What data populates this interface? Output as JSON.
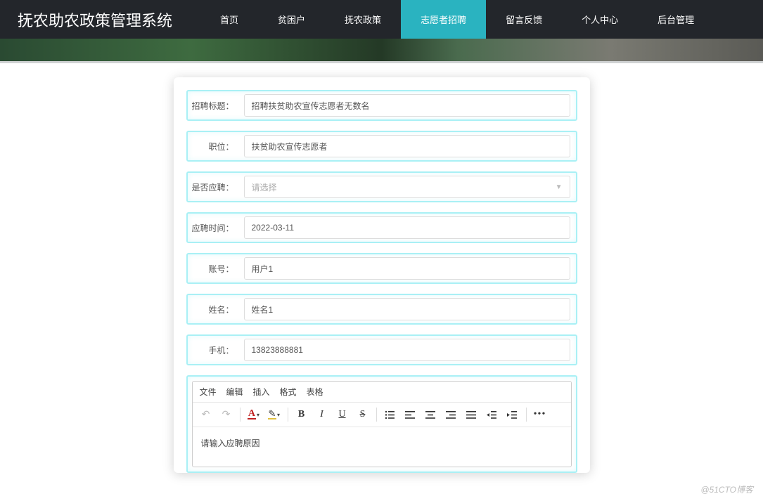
{
  "brand": "抚农助农政策管理系统",
  "nav": {
    "items": [
      {
        "label": "首页",
        "active": false
      },
      {
        "label": "贫困户",
        "active": false
      },
      {
        "label": "抚农政策",
        "active": false
      },
      {
        "label": "志愿者招聘",
        "active": true
      },
      {
        "label": "留言反馈",
        "active": false
      },
      {
        "label": "个人中心",
        "active": false
      },
      {
        "label": "后台管理",
        "active": false
      }
    ]
  },
  "form": {
    "title": {
      "label": "招聘标题：",
      "value": "招聘扶贫助农宣传志愿者无数名"
    },
    "position": {
      "label": "职位：",
      "value": "扶贫助农宣传志愿者"
    },
    "apply": {
      "label": "是否应聘：",
      "placeholder": "请选择"
    },
    "time": {
      "label": "应聘时间：",
      "value": "2022-03-11"
    },
    "account": {
      "label": "账号：",
      "value": "用户1"
    },
    "name": {
      "label": "姓名：",
      "value": "姓名1"
    },
    "phone": {
      "label": "手机：",
      "value": "13823888881"
    }
  },
  "editor": {
    "menus": [
      "文件",
      "编辑",
      "插入",
      "格式",
      "表格"
    ],
    "placeholder": "请输入应聘原因"
  },
  "watermark": "@51CTO博客"
}
